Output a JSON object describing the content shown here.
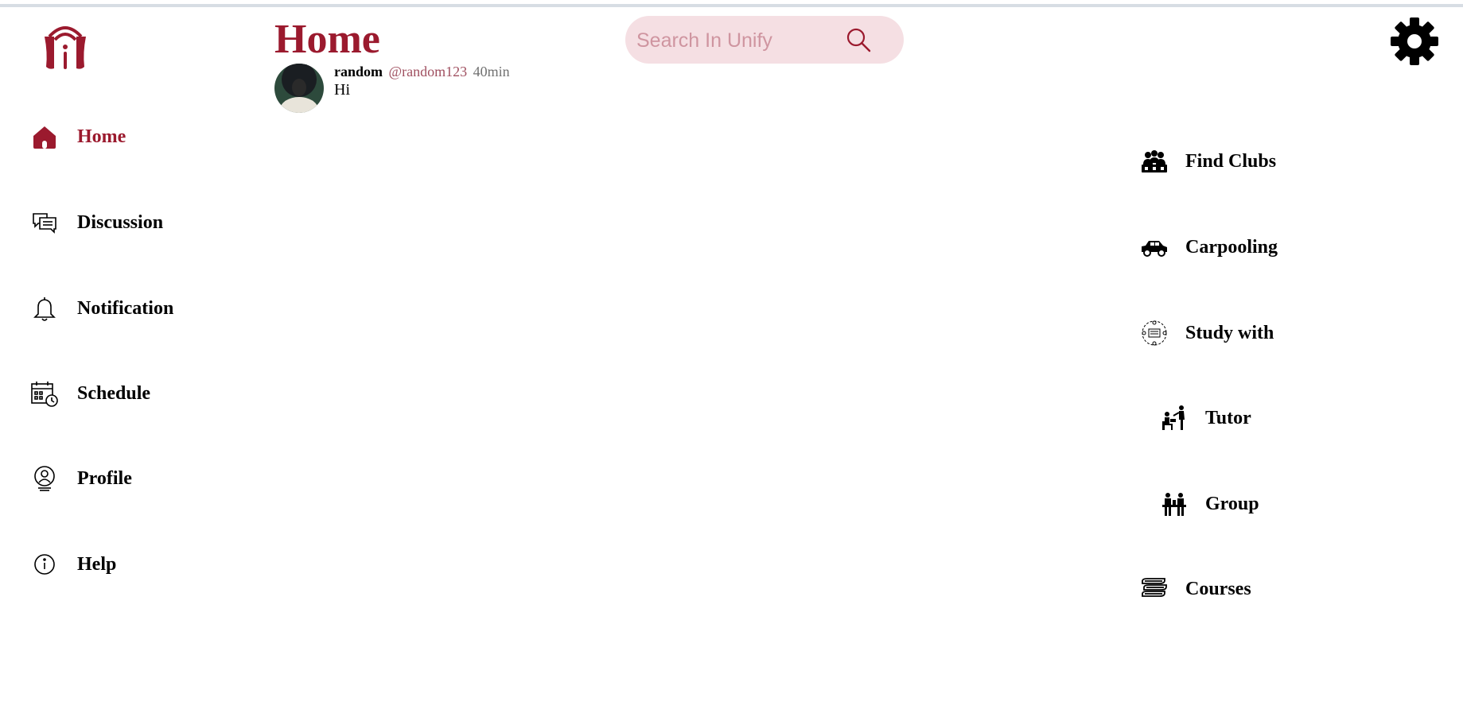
{
  "header": {
    "title": "Home",
    "search_placeholder": "Search In Unify"
  },
  "nav": {
    "items": [
      {
        "label": "Home",
        "icon": "home-icon",
        "active": true
      },
      {
        "label": "Discussion",
        "icon": "discussion-icon"
      },
      {
        "label": "Notification",
        "icon": "bell-icon"
      },
      {
        "label": "Schedule",
        "icon": "calendar-icon"
      },
      {
        "label": "Profile",
        "icon": "profile-icon"
      },
      {
        "label": "Help",
        "icon": "info-icon"
      }
    ]
  },
  "feed": {
    "posts": [
      {
        "author": "random",
        "handle": "@random123",
        "time": "40min",
        "body": "Hi"
      }
    ]
  },
  "sidebar": {
    "items": [
      {
        "label": "Find Clubs",
        "icon": "clubs-icon"
      },
      {
        "label": "Carpooling",
        "icon": "car-icon"
      },
      {
        "label": "Study with",
        "icon": "study-icon"
      },
      {
        "label": "Tutor",
        "icon": "tutor-icon"
      },
      {
        "label": "Group",
        "icon": "group-icon"
      },
      {
        "label": "Courses",
        "icon": "books-icon"
      }
    ]
  },
  "colors": {
    "accent": "#9b1a2e",
    "search_bg": "#f5dfe3",
    "handle": "#a05060"
  }
}
